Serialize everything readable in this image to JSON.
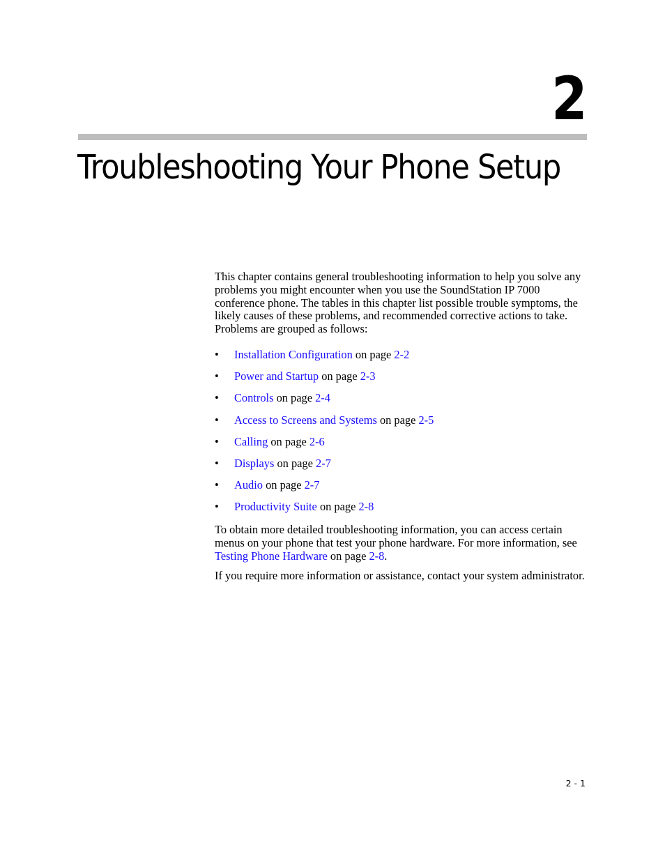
{
  "chapter": {
    "number": "2",
    "title": "Troubleshooting Your Phone Setup"
  },
  "intro_paragraph": "This chapter contains general troubleshooting information to help you solve any problems you might encounter when you use the SoundStation IP 7000 conference phone. The tables in this chapter list possible trouble symptoms, the likely causes of these problems, and recommended corrective actions to take. Problems are grouped as follows:",
  "bullet_symbol": "•",
  "on_page_text": " on page ",
  "topics": [
    {
      "label": "Installation Configuration",
      "page": "2-2"
    },
    {
      "label": "Power and Startup",
      "page": "2-3"
    },
    {
      "label": "Controls",
      "page": "2-4"
    },
    {
      "label": "Access to Screens and Systems",
      "page": "2-5"
    },
    {
      "label": "Calling",
      "page": "2-6"
    },
    {
      "label": "Displays",
      "page": "2-7"
    },
    {
      "label": "Audio",
      "page": "2-7"
    },
    {
      "label": "Productivity Suite",
      "page": "2-8"
    }
  ],
  "detail_paragraph": {
    "before": "To obtain more detailed troubleshooting information, you can access certain menus on your phone that test your phone hardware. For more information, see ",
    "link_label": "Testing Phone Hardware",
    "middle": " on page ",
    "page_link": "2-8",
    "after": "."
  },
  "contact_paragraph": "If you require more information or assistance, contact your system administrator.",
  "footer": {
    "page_number": "2 - 1"
  },
  "colors": {
    "link": "#1a0dff",
    "rule": "#bdbdbd"
  }
}
